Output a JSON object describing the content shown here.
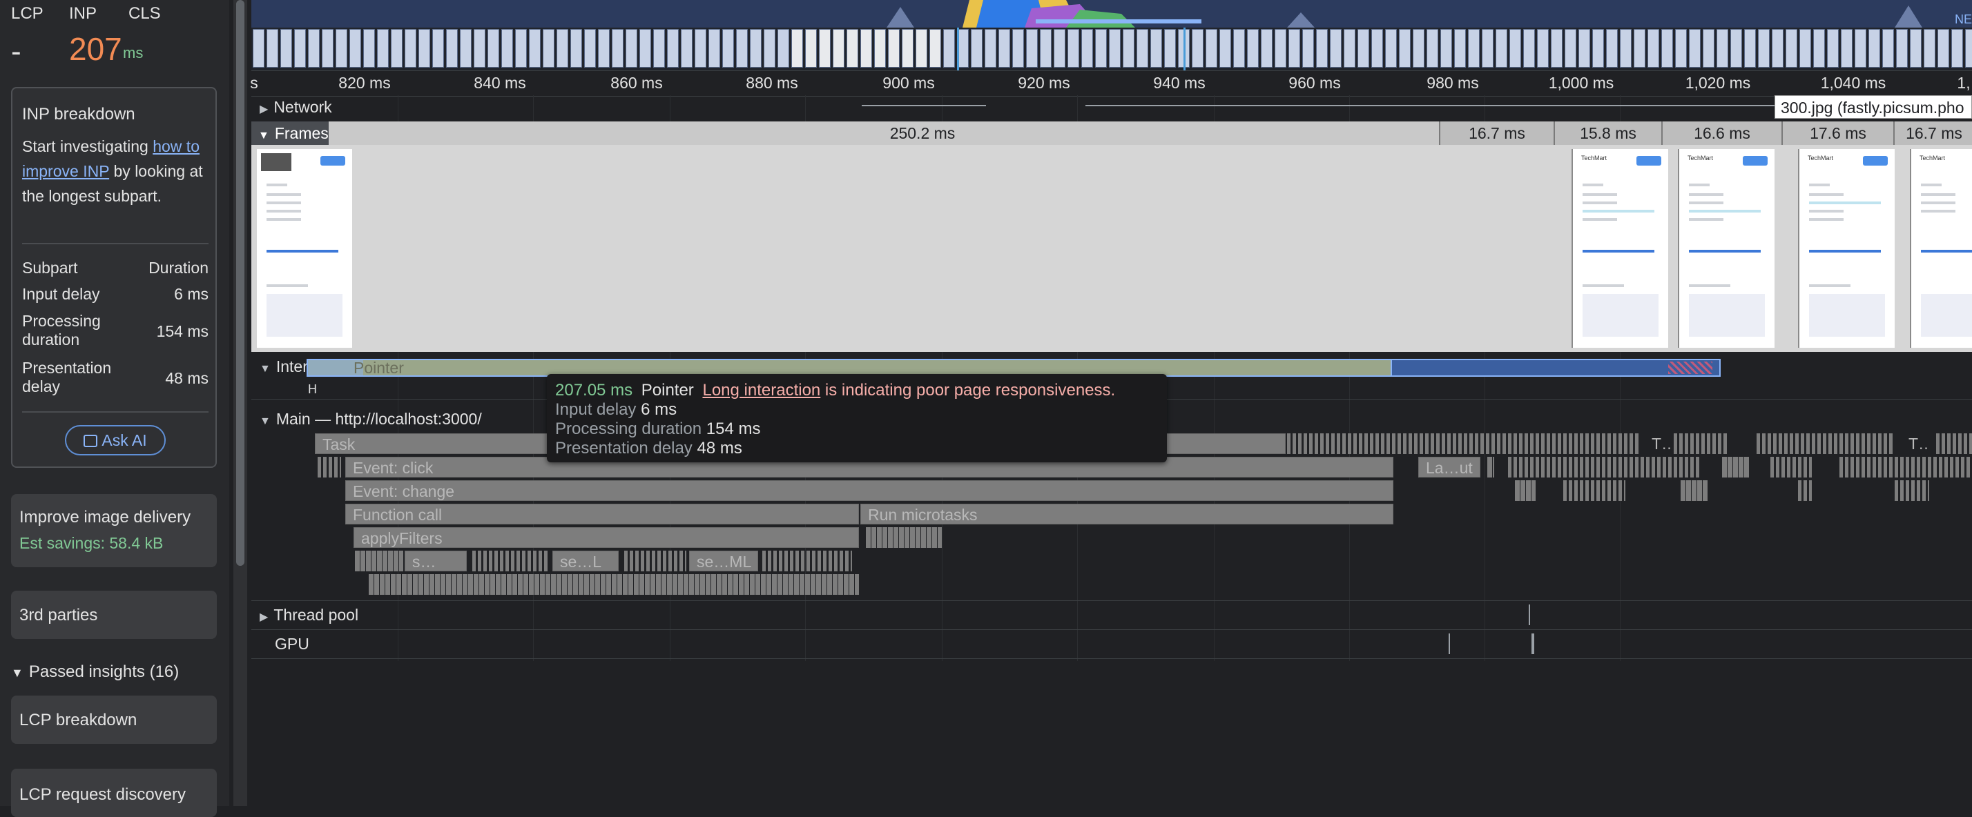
{
  "metrics": {
    "lcp_label": "LCP",
    "inp_label": "INP",
    "cls_label": "CLS",
    "lcp_value": "-",
    "inp_value": "207",
    "inp_unit": "ms"
  },
  "inp_breakdown": {
    "title": "INP breakdown",
    "text_before": "Start investigating ",
    "link": "how to improve INP",
    "text_after": " by looking at the longest subpart.",
    "col_subpart": "Subpart",
    "col_duration": "Duration",
    "rows": [
      {
        "name": "Input delay",
        "duration": "6 ms"
      },
      {
        "name": "Processing duration",
        "duration": "154 ms"
      },
      {
        "name": "Presentation delay",
        "duration": "48 ms"
      }
    ],
    "ask_ai": "Ask AI"
  },
  "insights": {
    "image_delivery": "Improve image delivery",
    "image_savings": "Est savings: 58.4 kB",
    "third_parties": "3rd parties",
    "passed": "Passed insights (16)",
    "lcp_breakdown": "LCP breakdown",
    "lcp_request": "LCP request discovery"
  },
  "ruler": {
    "ticks": [
      "s",
      "820 ms",
      "840 ms",
      "860 ms",
      "880 ms",
      "900 ms",
      "920 ms",
      "940 ms",
      "960 ms",
      "980 ms",
      "1,000 ms",
      "1,020 ms",
      "1,040 ms",
      "1,"
    ]
  },
  "tracks": {
    "network": "Network",
    "network_tooltip": "300.jpg (fastly.picsum.pho",
    "frames": "Frames",
    "frame_durations": [
      "250.2 ms",
      "16.7 ms",
      "15.8 ms",
      "16.6 ms",
      "17.6 ms",
      "16.7 ms"
    ],
    "interactions": "Interactions",
    "interaction_event": "Pointer",
    "interaction_marker": "H",
    "main": "Main — http://localhost:3000/",
    "thread_pool": "Thread pool",
    "gpu": "GPU"
  },
  "flame": {
    "task": "Task",
    "event_click": "Event: click",
    "event_change": "Event: change",
    "function_call": "Function call",
    "run_microtasks": "Run microtasks",
    "apply_filters": "applyFilters",
    "layout": "La…ut",
    "s1": "s…",
    "s2": "se…L",
    "s3": "se…ML",
    "t1": "T…",
    "t2": "T…"
  },
  "tooltip": {
    "time": "207.05 ms",
    "type": "Pointer",
    "link": "Long interaction",
    "message": " is indicating poor page responsiveness.",
    "input_delay_label": "Input delay",
    "input_delay": "6 ms",
    "processing_label": "Processing duration",
    "processing": "154 ms",
    "presentation_label": "Presentation delay",
    "presentation": "48 ms"
  },
  "thumb_brand": "TechMart",
  "overview_label": "NE",
  "colors": {
    "inp_poor": "#f28b54",
    "inp_unit": "#81c995",
    "savings": "#81c995",
    "tooltip_time": "#81c995",
    "tooltip_link": "#f6aea9",
    "selection": "#8ab4f8"
  }
}
